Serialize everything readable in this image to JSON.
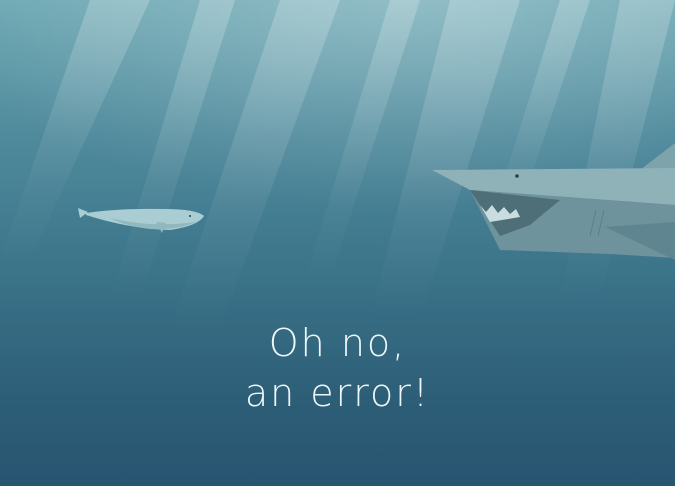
{
  "error_page": {
    "heading_line_1": "Oh no,",
    "heading_line_2": "an error!"
  },
  "illustration": {
    "scene": "underwater",
    "icons": [
      "light-rays",
      "small-whale-icon",
      "shark-icon"
    ]
  },
  "colors": {
    "water_top": "#6da8b3",
    "water_bottom": "#285571",
    "whale": "#a9cdd2",
    "shark_body": "#7fa3ab",
    "text": "#eef6f8"
  }
}
